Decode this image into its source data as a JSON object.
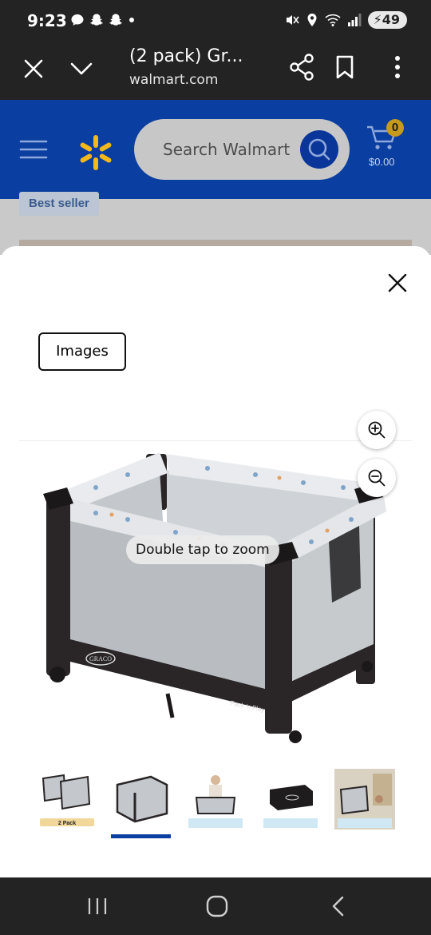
{
  "status_bar": {
    "time": "9:23",
    "notification_icons": [
      "messages-icon",
      "snapchat-icon",
      "snapchat-icon",
      "dot-icon"
    ],
    "system_icons": [
      "mute-icon",
      "location-icon",
      "wifi-icon",
      "signal-icon"
    ],
    "battery": "49"
  },
  "browser": {
    "title": "(2 pack) Gr...",
    "url": "walmart.com"
  },
  "walmart": {
    "search_placeholder": "Search Walmart",
    "cart_count": "0",
    "cart_total": "$0.00",
    "brand_color": "#0a3ea0",
    "spark_color": "#f5b819"
  },
  "page_behind": {
    "badge": "Best seller"
  },
  "modal": {
    "images_button": "Images",
    "zoom_hint": "Double tap to zoom",
    "thumbnails": [
      {
        "name": "thumbnail-2-pack",
        "caption": "2 Pack"
      },
      {
        "name": "thumbnail-playard-front",
        "caption": ""
      },
      {
        "name": "thumbnail-folding-playard",
        "caption": ""
      },
      {
        "name": "thumbnail-carry-bag",
        "caption": ""
      },
      {
        "name": "thumbnail-room-scene",
        "caption": ""
      }
    ],
    "selected_thumbnail": 1
  },
  "product_image": {
    "brand_mark": "GRACO",
    "side_label": "Pack 'n Play"
  }
}
